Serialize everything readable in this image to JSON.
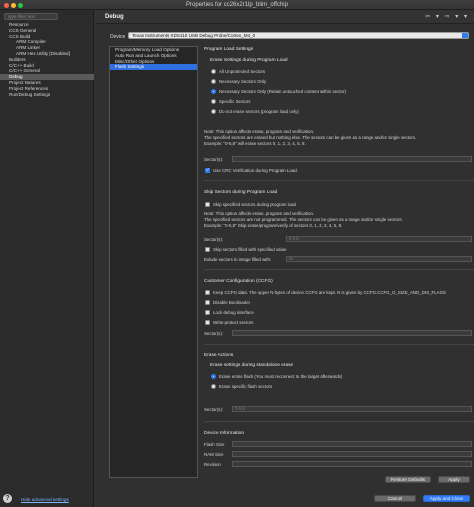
{
  "window": {
    "title": "Properties for cc26x2r1lp_blim_offchip"
  },
  "sidebar": {
    "filter_placeholder": "type filter text",
    "items": [
      {
        "label": "Resource",
        "indent": false,
        "selected": false
      },
      {
        "label": "CCS General",
        "indent": false,
        "selected": false
      },
      {
        "label": "CCS Build",
        "indent": false,
        "selected": false
      },
      {
        "label": "ARM Compiler",
        "indent": true,
        "selected": false
      },
      {
        "label": "ARM Linker",
        "indent": true,
        "selected": false
      },
      {
        "label": "ARM Hex Utility  [Disabled]",
        "indent": true,
        "selected": false
      },
      {
        "label": "Builders",
        "indent": false,
        "selected": false
      },
      {
        "label": "C/C++ Build",
        "indent": false,
        "selected": false
      },
      {
        "label": "C/C++ General",
        "indent": false,
        "selected": false
      },
      {
        "label": "Debug",
        "indent": false,
        "selected": true
      },
      {
        "label": "Project Natures",
        "indent": false,
        "selected": false
      },
      {
        "label": "Project References",
        "indent": false,
        "selected": false
      },
      {
        "label": "Run/Debug Settings",
        "indent": false,
        "selected": false
      }
    ],
    "help_glyph": "?",
    "hide_advanced_label": "Hide advanced settings"
  },
  "page": {
    "title": "Debug",
    "nav_glyphs": "⇦ ▾ ⇨ ▾ ▾",
    "device_label": "Device",
    "device_value": "Texas Instruments XDS110 USB Debug Probe/Cortex_M4_0"
  },
  "sublist": {
    "items": [
      {
        "label": "Program/Memory Load Options",
        "selected": false
      },
      {
        "label": "Auto Run and Launch Options",
        "selected": false
      },
      {
        "label": "Misc/Other Options",
        "selected": false
      },
      {
        "label": "Flash Settings",
        "selected": true
      }
    ]
  },
  "flash": {
    "program_load_heading": "Program Load Settings",
    "erase_during_load_heading": "Erase Settings during Program Load",
    "erase_options": [
      {
        "label": "All Unprotected Sectors",
        "checked": false
      },
      {
        "label": "Necessary Sectors Only",
        "checked": false
      },
      {
        "label": "Necessary Sectors Only (Retain untouched content within sector)",
        "checked": true
      },
      {
        "label": "Specific Sectors",
        "checked": false
      },
      {
        "label": "Do not erase sectors (program load only)",
        "checked": false
      }
    ],
    "note1": [
      "Note: This option affects erase, program and verification.",
      "The specified sectors are erased but nothing else. The sectors can be given as a range and/or single sectors.",
      "Example: \"0-5,8\" will erase sectors 0, 1, 2, 3, 4, 5, 8."
    ],
    "sectors_label": "Sector(s):",
    "sectors_value": "",
    "crc_label": "Use CRC Verification during Program Load.",
    "crc_checked": true,
    "skip_heading": "Skip Sectors during Program Load",
    "skip_specified_label": "Skip specified sectors during program load",
    "skip_specified_checked": false,
    "note2": [
      "Note: This option affects erase, program and verification.",
      "The specified sectors are not programmed. The sectors can be given as a range and/or single sectors.",
      "Example: \"0-5,8\" Skip erase/program/verify of sectors 0, 1, 2, 3, 4, 5, 8."
    ],
    "skip_sectors_label": "Sector(s):",
    "skip_sectors_value": "0-5,8",
    "skip_filled_label": "Skip sectors filled with specified value",
    "skip_filled_checked": false,
    "exclude_label": "Exlude sectors in image filled with:",
    "exclude_value": "0x",
    "ccfg_heading": "Customer Configuration (CCFG)",
    "ccfg_options": [
      {
        "label": "Keep CCFG data. The upper N bytes of device CCFG are kept. N is given by CCFG.CCFG_O_SIZE_AND_DIS_FLAGS",
        "checked": false
      },
      {
        "label": "Disable Bootloader",
        "checked": false
      },
      {
        "label": "Lock debug interface",
        "checked": false
      },
      {
        "label": "Write-protect sectors",
        "checked": false
      }
    ],
    "ccfg_sectors_label": "Sector(s):",
    "ccfg_sectors_value": "",
    "erase_actions_heading": "Erase Actions",
    "standalone_heading": "Erase settings during standalone erase",
    "standalone_options": [
      {
        "label": "Erase entire flash (You must reconnect to the target afterwards)",
        "checked": true
      },
      {
        "label": "Erase specific flash sectors",
        "checked": false
      }
    ],
    "erase_sectors_label": "Sector(s):",
    "erase_sectors_value": "0-5,8",
    "device_info_heading": "Device Information",
    "flash_size_label": "Flash Size",
    "ram_size_label": "RAM Size",
    "revision_label": "Revision",
    "flash_size_value": "",
    "ram_size_value": "",
    "revision_value": ""
  },
  "buttons": {
    "restore_defaults": "Restore Defaults",
    "apply": "Apply",
    "cancel": "Cancel",
    "apply_close": "Apply and Close"
  }
}
